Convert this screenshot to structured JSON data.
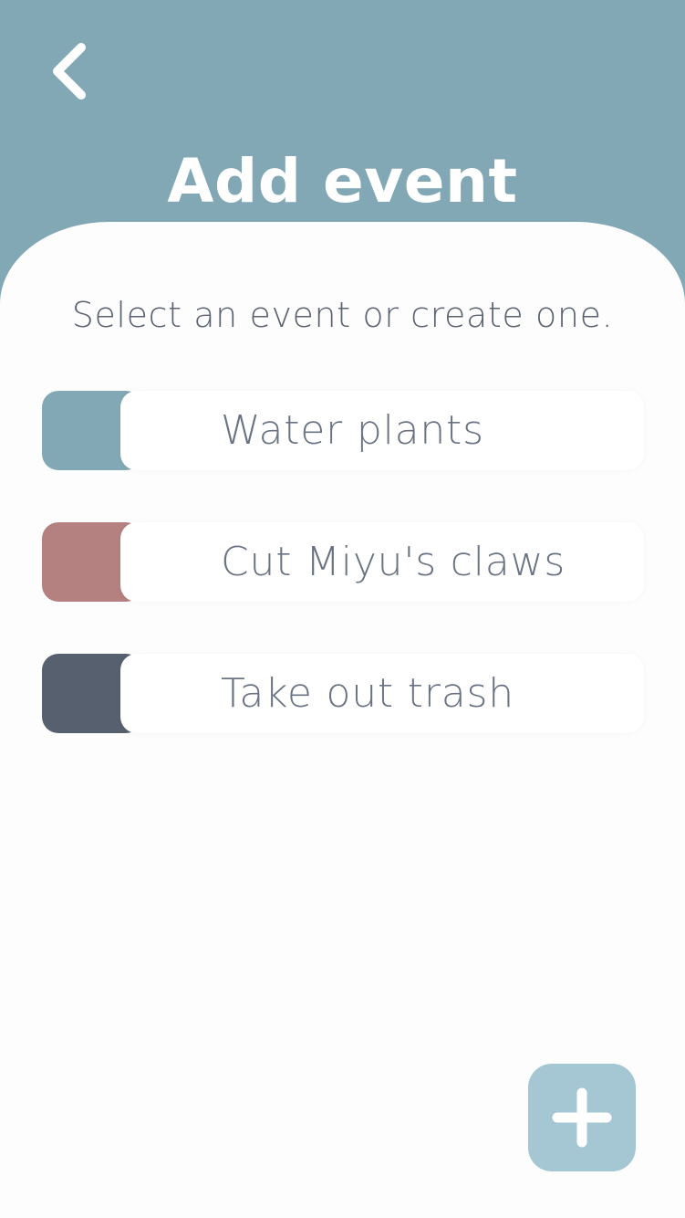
{
  "header": {
    "back_icon": "chevron-left-icon",
    "title": "Add event"
  },
  "content": {
    "subtitle": "Select an event or create one.",
    "events": [
      {
        "label": "Water plants",
        "color": "#82a8b5"
      },
      {
        "label": "Cut Miyu's claws",
        "color": "#b48180"
      },
      {
        "label": "Take out trash",
        "color": "#56606e"
      }
    ]
  },
  "add_button": {
    "icon": "plus-icon"
  },
  "colors": {
    "header_background": "#82a8b5",
    "sheet_background": "#fdfdfd",
    "add_button_background": "#a5c7d3",
    "text": "#6a7383"
  }
}
